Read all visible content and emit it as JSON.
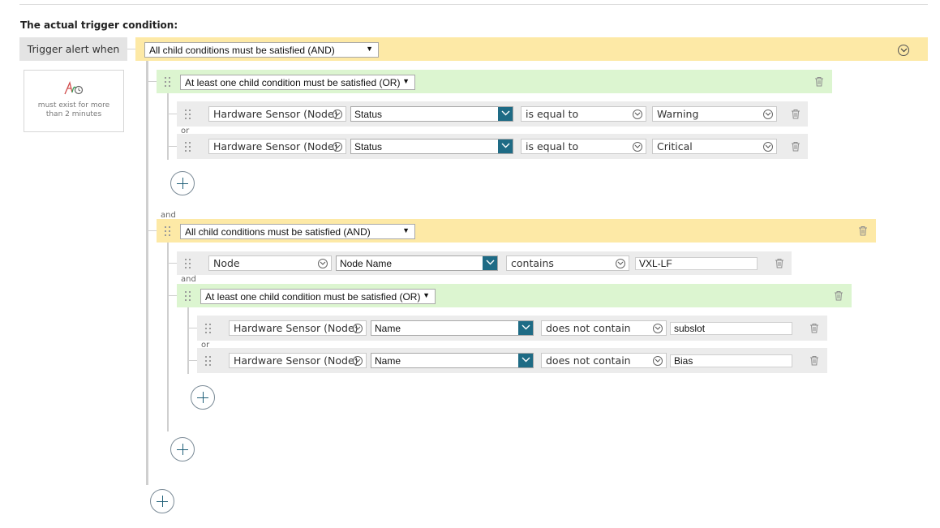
{
  "heading": "The actual trigger condition:",
  "trigger_label": "Trigger alert when",
  "duration": {
    "line1": "must exist for more",
    "line2": "than 2 minutes"
  },
  "root": {
    "mode": "All child conditions must be satisfied (AND)"
  },
  "group1": {
    "mode": "At least one child condition must be satisfied (OR)",
    "rows": [
      {
        "object": "Hardware Sensor (Node)",
        "field": "Status",
        "operator": "is equal to",
        "value": "Warning"
      },
      {
        "object": "Hardware Sensor (Node)",
        "field": "Status",
        "operator": "is equal to",
        "value": "Critical"
      }
    ],
    "join": "or"
  },
  "join_and": "and",
  "group2": {
    "mode": "All child conditions must be satisfied (AND)",
    "row": {
      "object": "Node",
      "field": "Node Name",
      "operator": "contains",
      "value": "VXL-LF"
    },
    "join": "and",
    "sub": {
      "mode": "At least one child condition must be satisfied (OR)",
      "rows": [
        {
          "object": "Hardware Sensor (Node)",
          "field": "Name",
          "operator": "does not contain",
          "value": "subslot"
        },
        {
          "object": "Hardware Sensor (Node)",
          "field": "Name",
          "operator": "does not contain",
          "value": "Bias"
        }
      ],
      "join": "or"
    }
  },
  "colors": {
    "and_bar": "#fde9a6",
    "or_bar": "#dcf5d0",
    "accent": "#1e6b85"
  }
}
